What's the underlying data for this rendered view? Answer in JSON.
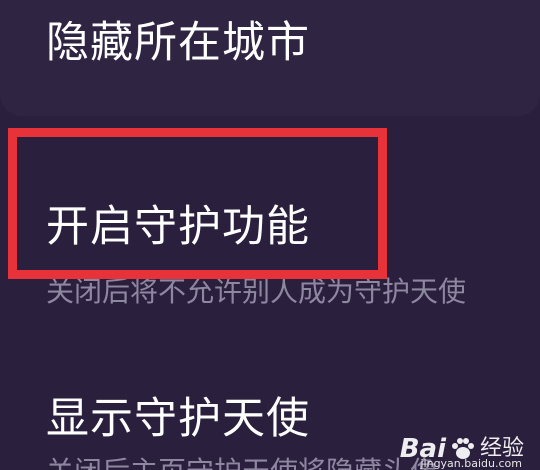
{
  "settings": {
    "items": [
      {
        "title": "隐藏所在城市"
      },
      {
        "title": "开启守护功能",
        "desc": "关闭后将不允许别人成为守护天使"
      },
      {
        "title": "显示守护天使",
        "desc": "关闭后主页守护天使将隐藏头像"
      }
    ]
  },
  "watermark": {
    "brand": "Bai",
    "brand_suffix": "经验",
    "url": "jingyan.baidu.com"
  },
  "colors": {
    "background": "#2a1f3d",
    "card": "#2f2442",
    "title_text": "#ffffff",
    "desc_text": "#8e87a0",
    "highlight_border": "#e8323a"
  }
}
